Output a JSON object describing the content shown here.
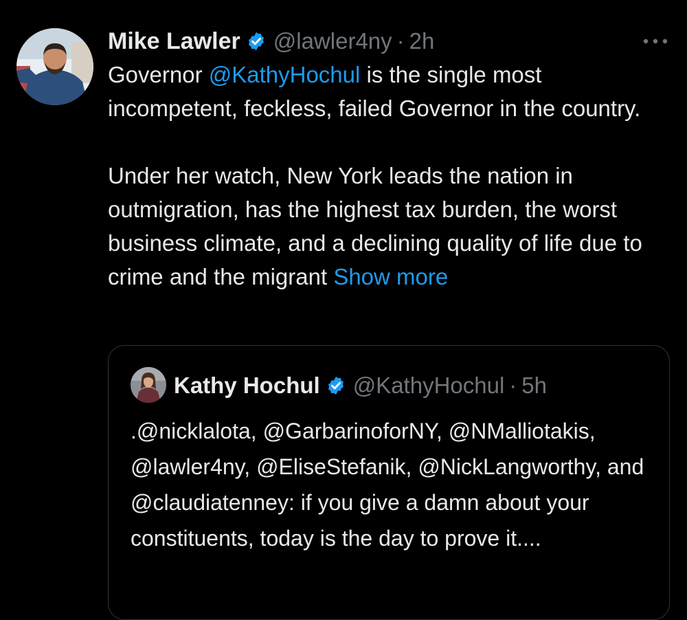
{
  "tweet": {
    "author_name": "Mike Lawler",
    "author_handle": "@lawler4ny",
    "separator": "·",
    "time": "2h",
    "text_part1": "Governor ",
    "mention": "@KathyHochul",
    "text_part2": " is the single most incompetent, feckless, failed Governor in the country.",
    "text_paragraph2": "Under her watch, New York leads the nation in outmigration, has the highest tax burden, the worst business climate, and a declining quality of life due to crime and the migrant ",
    "show_more": "Show more",
    "more_icon": "more-horizontal-icon",
    "verified_icon": "verified-badge-icon"
  },
  "quoted_tweet": {
    "author_name": "Kathy Hochul",
    "author_handle": "@KathyHochul",
    "separator": "·",
    "time": "5h",
    "text": ".@nicklalota, @GarbarinoforNY, @NMalliotakis, @lawler4ny, @EliseStefanik, @NickLangworthy, and @claudiatenney: if you give a damn about your constituents, today is the day to prove it...."
  },
  "colors": {
    "background": "#000000",
    "text": "#e7e9ea",
    "secondary": "#71767b",
    "accent": "#1d9bf0",
    "border": "#2f3336"
  }
}
